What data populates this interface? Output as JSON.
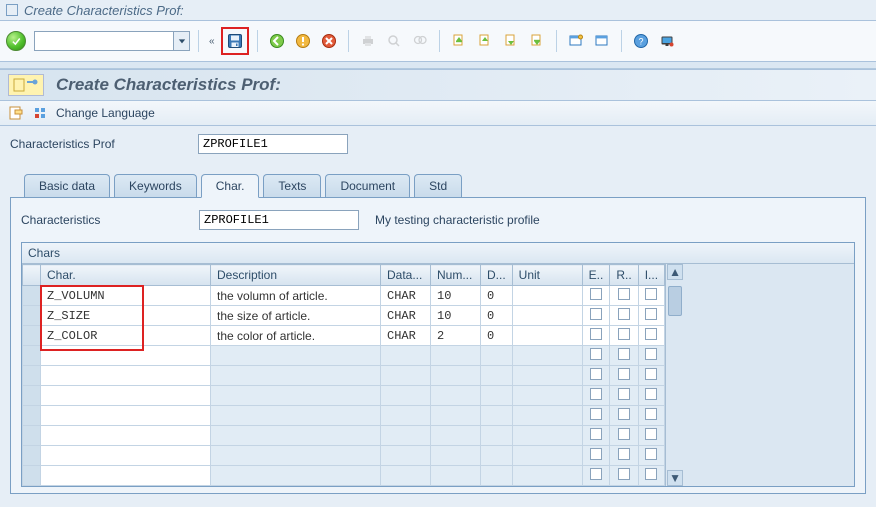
{
  "window": {
    "title": "Create Characteristics Prof:"
  },
  "toolbar": {
    "input_value": "",
    "save_tooltip": "Save"
  },
  "page_header": {
    "title": "Create Characteristics Prof:"
  },
  "sub_toolbar": {
    "change_language": "Change Language"
  },
  "form": {
    "char_prof_label": "Characteristics Prof",
    "char_prof_value": "ZPROFILE1"
  },
  "tabs": {
    "basic": "Basic data",
    "keywords": "Keywords",
    "char": "Char.",
    "texts": "Texts",
    "document": "Document",
    "std": "Std"
  },
  "char_tab": {
    "characteristics_label": "Characteristics",
    "characteristics_value": "ZPROFILE1",
    "characteristics_desc": "My testing characteristic profile"
  },
  "grid": {
    "title": "Chars",
    "columns": {
      "char": "Char.",
      "description": "Description",
      "data": "Data...",
      "num": "Num...",
      "d": "D...",
      "unit": "Unit",
      "e": "E..",
      "r": "R..",
      "i": "I..."
    },
    "rows": [
      {
        "char": "Z_VOLUMN",
        "desc": "the volumn of article.",
        "data": "CHAR",
        "num": "10",
        "d": "0",
        "unit": ""
      },
      {
        "char": "Z_SIZE",
        "desc": "the size of article.",
        "data": "CHAR",
        "num": "10",
        "d": "0",
        "unit": ""
      },
      {
        "char": "Z_COLOR",
        "desc": "the color of article.",
        "data": "CHAR",
        "num": "2",
        "d": "0",
        "unit": ""
      }
    ],
    "empty_row_count": 7
  }
}
